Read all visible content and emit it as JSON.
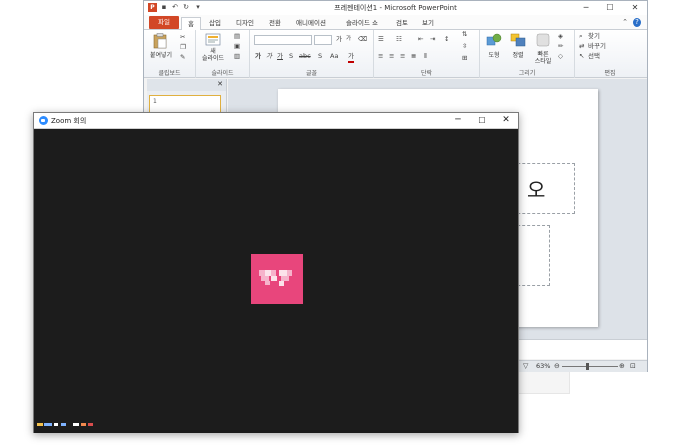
{
  "ppt": {
    "title": "프레젠테이션1 - Microsoft PowerPoint",
    "logo_letter": "P",
    "qat_icons": [
      "save-icon",
      "undo-icon",
      "redo-icon",
      "customize-icon"
    ],
    "window_controls": {
      "minimize": "─",
      "maximize": "☐",
      "close": "✕"
    },
    "tabs": [
      {
        "label": "파일"
      },
      {
        "label": "홈"
      },
      {
        "label": "삽입"
      },
      {
        "label": "디자인"
      },
      {
        "label": "전환"
      },
      {
        "label": "애니메이션"
      },
      {
        "label": "슬라이드 쇼"
      },
      {
        "label": "검토"
      },
      {
        "label": "보기"
      }
    ],
    "ribbon": {
      "clipboard": {
        "label": "클립보드",
        "paste": "붙여넣기"
      },
      "slides": {
        "label": "슬라이드",
        "new_slide_line1": "새",
        "new_slide_line2": "슬라이드"
      },
      "font": {
        "label": "글꼴",
        "bold": "가",
        "italic": "가",
        "underline": "가",
        "strike": "S",
        "spacing": "abc",
        "size_up": "가",
        "size_down": "가",
        "shadow": "S",
        "case": "Aa",
        "color": "가"
      },
      "paragraph": {
        "label": "단락"
      },
      "drawing": {
        "label": "그리기",
        "shapes": "도형",
        "arrange": "정렬",
        "quick_styles_line1": "빠른",
        "quick_styles_line2": "스타일"
      },
      "editing": {
        "label": "편집",
        "find": "찾기",
        "replace": "바꾸기",
        "select": "선택"
      }
    },
    "left_panel": {
      "close": "✕",
      "thumb_number": "1"
    },
    "slide": {
      "title_fragment": "오"
    },
    "status": {
      "zoom_percent": "63%"
    }
  },
  "zoom": {
    "title": "Zoom 회의",
    "window_controls": {
      "minimize": "─",
      "maximize": "☐",
      "close": "✕"
    }
  }
}
